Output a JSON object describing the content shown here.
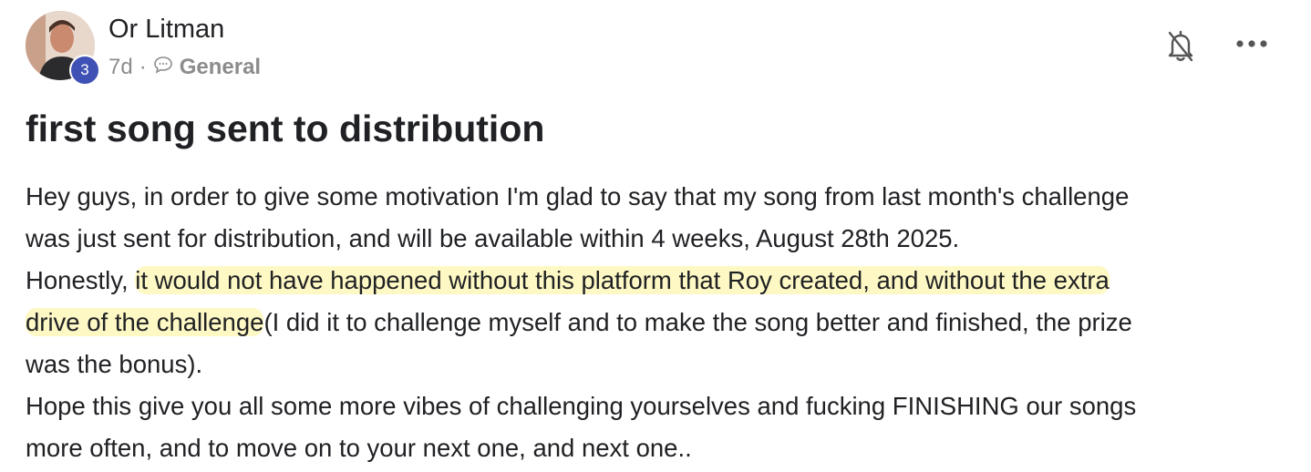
{
  "post": {
    "author": "Or Litman",
    "level": "3",
    "time": "7d",
    "separator": "·",
    "category": "General",
    "title": "first song sent to distribution",
    "p1_line1": "Hey guys, in order to give some motivation I'm glad to say that my song from last month's challenge",
    "p1_line2": "was just sent for distribution, and will be available within 4 weeks, August 28th 2025.",
    "p2_pre": "Honestly, ",
    "p2_highlight1": "it would not have happened without this platform that Roy created, and without the extra",
    "p2_highlight2": "drive of the challenge",
    "p2_rest": "(I did it to challenge myself and to make the song better and finished, the prize",
    "p2_line3": "was the bonus).",
    "p3_line1": "Hope this give you all some more vibes of challenging yourselves and fucking FINISHING our songs",
    "p3_line2": "more often, and to move on to your next one, and next one.."
  },
  "icons": {
    "notification": "bell-slash-icon",
    "more": "more-horizontal-icon",
    "category": "chat-bubble-icon"
  },
  "colors": {
    "badge": "#3f51b5",
    "highlight": "#fdf8c4",
    "meta_text": "#8c8c8c"
  }
}
